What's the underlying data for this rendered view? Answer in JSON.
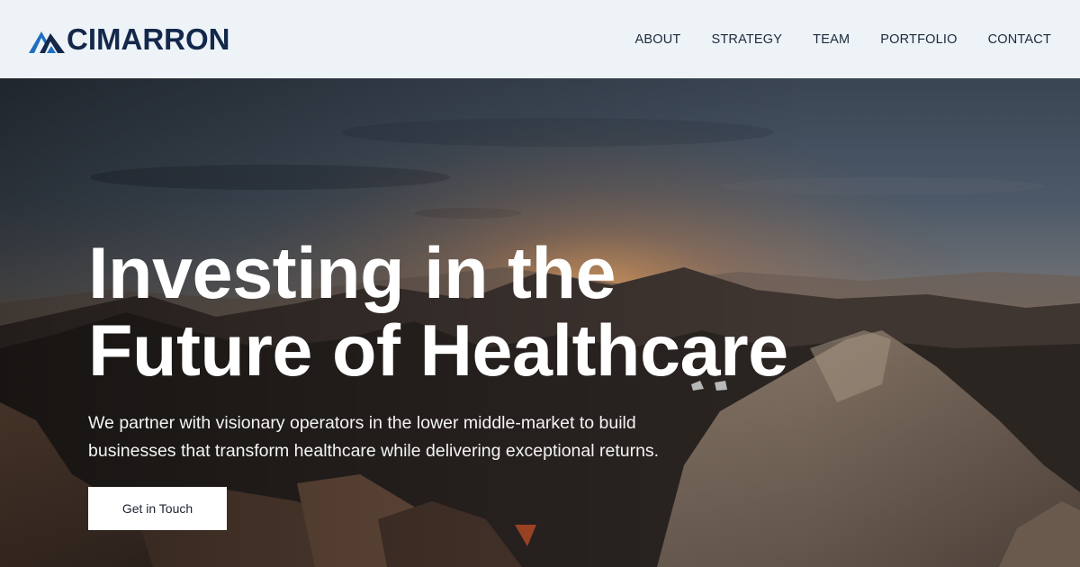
{
  "brand": {
    "name": "CIMARRON",
    "logo_icon": "mountain-peaks-icon",
    "colors": {
      "primary": "#13284a",
      "accent": "#1f6fc0"
    }
  },
  "nav": {
    "items": [
      {
        "label": "ABOUT"
      },
      {
        "label": "STRATEGY"
      },
      {
        "label": "TEAM"
      },
      {
        "label": "PORTFOLIO"
      },
      {
        "label": "CONTACT"
      }
    ]
  },
  "hero": {
    "headline_line1": "Investing in the",
    "headline_line2": "Future of Healthcare",
    "subtext_line1": "We partner with visionary operators in the lower middle-market to build",
    "subtext_line2": "businesses that transform healthcare while delivering exceptional returns.",
    "cta_label": "Get in Touch",
    "background": "mountain-sunset-photo"
  }
}
